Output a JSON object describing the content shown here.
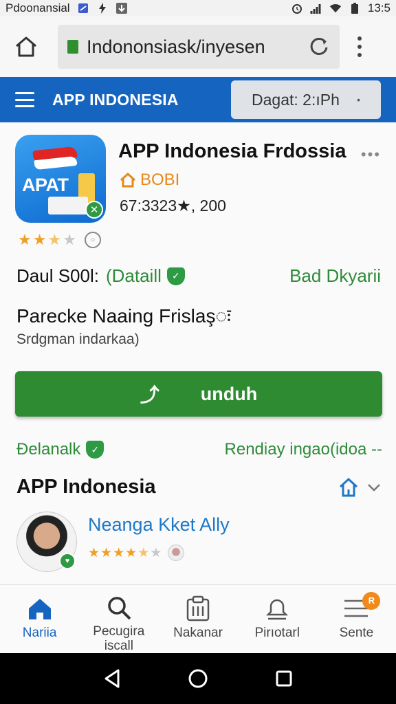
{
  "status_bar": {
    "carrier": "Pdoonansial",
    "time": "13:5"
  },
  "browser": {
    "url": "Indononsiask/inyesen"
  },
  "header": {
    "title": "APP INDONESIA",
    "language_select": "Dagat: 2:ıPh"
  },
  "app": {
    "icon_text": "APAT",
    "name": "APP Indonesia Frdossia",
    "developer": "BOBI",
    "stats": "67:3323★, 200",
    "rating": 2.5
  },
  "details": {
    "label": "Daul S00l:",
    "link": "(Dataill",
    "right_link": "Bad Dkyarii"
  },
  "heading2": "Parecke Naaing Frislaşः",
  "subheading2": "Srdgman indarkaa)",
  "download": {
    "label": "unduh"
  },
  "links": {
    "left": "Đelanalk",
    "right": "Rendiay ingao(idoa --"
  },
  "section": {
    "title": "APP Indonesia"
  },
  "review": {
    "reviewer": "Neanga Kket Ally",
    "rating": 4.5
  },
  "bottom_nav": {
    "items": [
      {
        "label": "Nariia",
        "icon": "home-icon",
        "active": true
      },
      {
        "label": "Pecugira iscall",
        "icon": "search-icon",
        "active": false
      },
      {
        "label": "Nakanar",
        "icon": "clipboard-icon",
        "active": false
      },
      {
        "label": "Pirıotarl",
        "icon": "bell-icon",
        "active": false
      },
      {
        "label": "Sente",
        "icon": "menu-icon",
        "active": false,
        "badge": "R"
      }
    ]
  },
  "colors": {
    "primary": "#1565c0",
    "download": "#2e8b32",
    "link": "#2e8b3a",
    "developer": "#e6891a",
    "star": "#f0a028"
  }
}
